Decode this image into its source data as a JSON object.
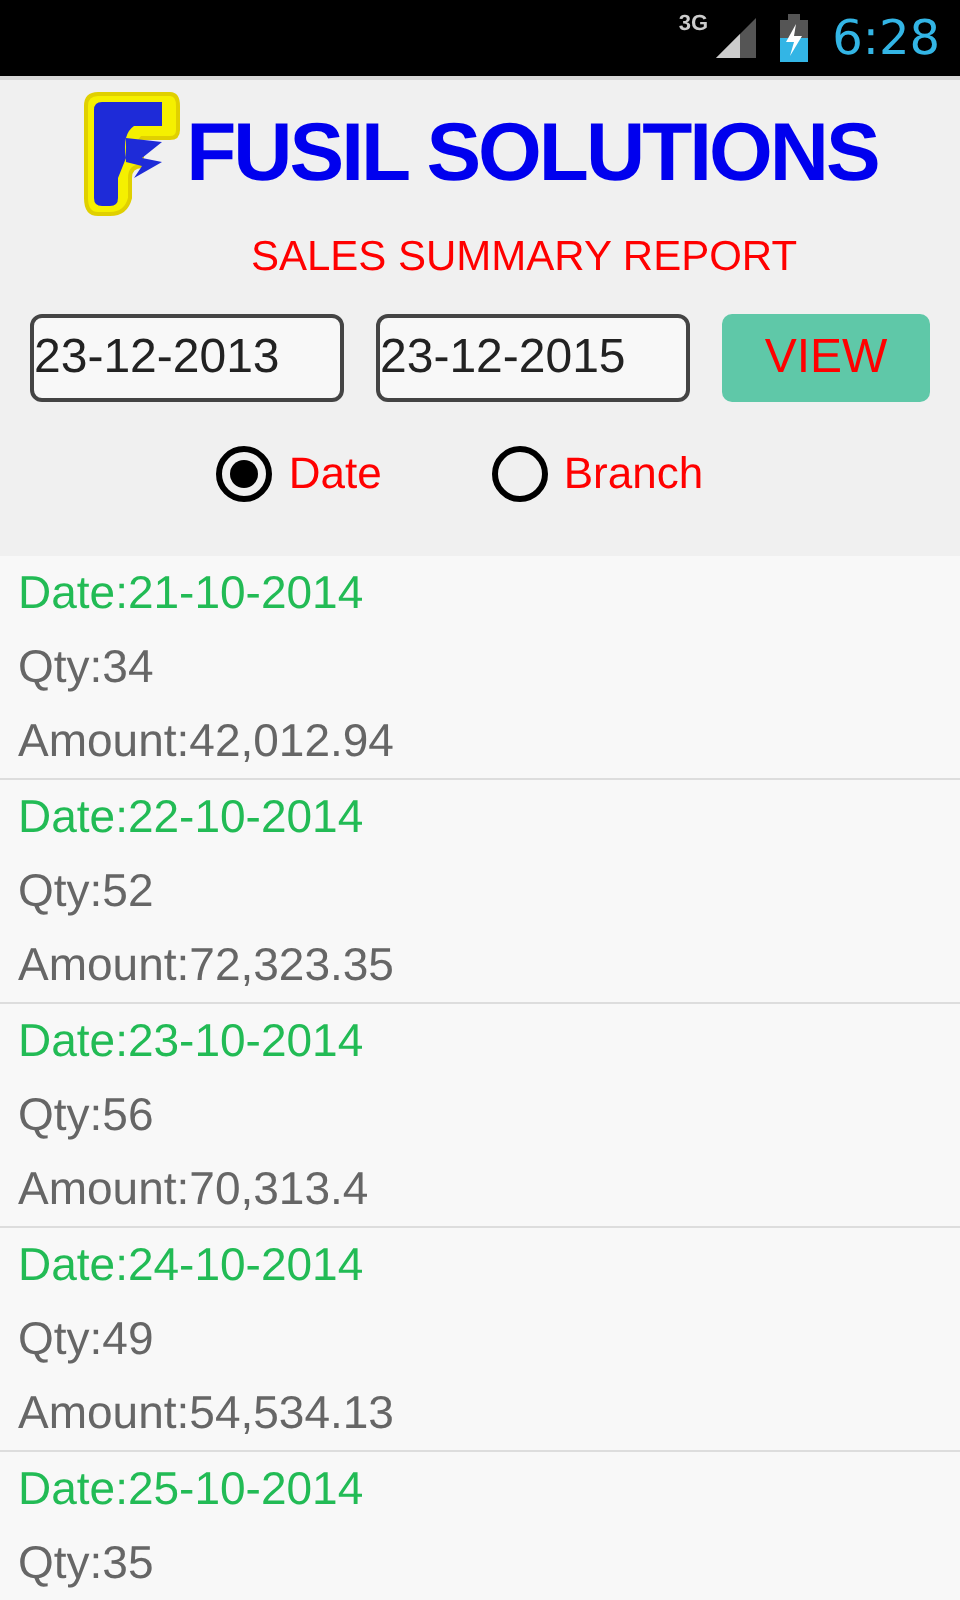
{
  "status_bar": {
    "network": "3G",
    "time": "6:28"
  },
  "header": {
    "title": "FUSIL SOLUTIONS",
    "subtitle": "SALES SUMMARY REPORT"
  },
  "filters": {
    "from_date": "23-12-2013",
    "to_date": "23-12-2015",
    "button": "VIEW"
  },
  "group_by": [
    {
      "label": "Date",
      "selected": true
    },
    {
      "label": "Branch",
      "selected": false
    }
  ],
  "rows": [
    {
      "date": "Date:21-10-2014",
      "qty": "Qty:34",
      "amount": "Amount:42,012.94"
    },
    {
      "date": "Date:22-10-2014",
      "qty": "Qty:52",
      "amount": "Amount:72,323.35"
    },
    {
      "date": "Date:23-10-2014",
      "qty": "Qty:56",
      "amount": "Amount:70,313.4"
    },
    {
      "date": "Date:24-10-2014",
      "qty": "Qty:49",
      "amount": "Amount:54,534.13"
    },
    {
      "date": "Date:25-10-2014",
      "qty": "Qty:35"
    }
  ]
}
